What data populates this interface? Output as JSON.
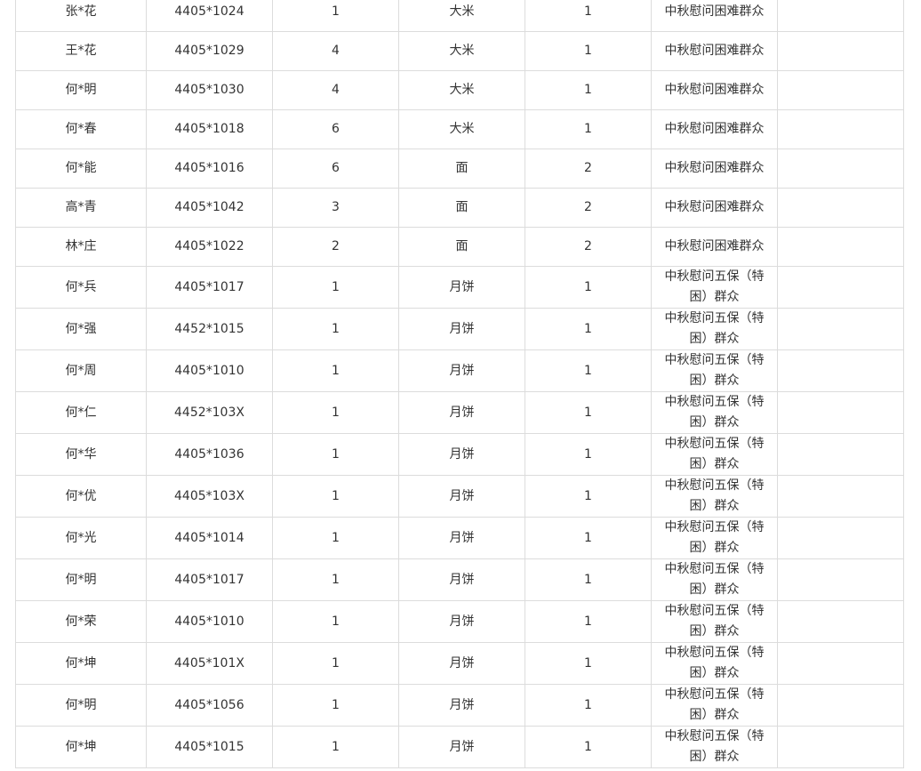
{
  "rows": [
    {
      "name": "张*花",
      "id": "4405*1024",
      "count": "1",
      "item": "大米",
      "qty": "1",
      "category": "中秋慰问困难群众",
      "note": ""
    },
    {
      "name": "王*花",
      "id": "4405*1029",
      "count": "4",
      "item": "大米",
      "qty": "1",
      "category": "中秋慰问困难群众",
      "note": ""
    },
    {
      "name": "何*明",
      "id": "4405*1030",
      "count": "4",
      "item": "大米",
      "qty": "1",
      "category": "中秋慰问困难群众",
      "note": ""
    },
    {
      "name": "何*春",
      "id": "4405*1018",
      "count": "6",
      "item": "大米",
      "qty": "1",
      "category": "中秋慰问困难群众",
      "note": ""
    },
    {
      "name": "何*能",
      "id": "4405*1016",
      "count": "6",
      "item": "面",
      "qty": "2",
      "category": "中秋慰问困难群众",
      "note": ""
    },
    {
      "name": "高*青",
      "id": "4405*1042",
      "count": "3",
      "item": "面",
      "qty": "2",
      "category": "中秋慰问困难群众",
      "note": ""
    },
    {
      "name": "林*庄",
      "id": "4405*1022",
      "count": "2",
      "item": "面",
      "qty": "2",
      "category": "中秋慰问困难群众",
      "note": ""
    },
    {
      "name": "何*兵",
      "id": "4405*1017",
      "count": "1",
      "item": "月饼",
      "qty": "1",
      "category": "中秋慰问五保（特困）群众",
      "note": ""
    },
    {
      "name": "何*强",
      "id": "4452*1015",
      "count": "1",
      "item": "月饼",
      "qty": "1",
      "category": "中秋慰问五保（特困）群众",
      "note": ""
    },
    {
      "name": "何*周",
      "id": "4405*1010",
      "count": "1",
      "item": "月饼",
      "qty": "1",
      "category": "中秋慰问五保（特困）群众",
      "note": ""
    },
    {
      "name": "何*仁",
      "id": "4452*103X",
      "count": "1",
      "item": "月饼",
      "qty": "1",
      "category": "中秋慰问五保（特困）群众",
      "note": ""
    },
    {
      "name": "何*华",
      "id": "4405*1036",
      "count": "1",
      "item": "月饼",
      "qty": "1",
      "category": "中秋慰问五保（特困）群众",
      "note": ""
    },
    {
      "name": "何*优",
      "id": "4405*103X",
      "count": "1",
      "item": "月饼",
      "qty": "1",
      "category": "中秋慰问五保（特困）群众",
      "note": ""
    },
    {
      "name": "何*光",
      "id": "4405*1014",
      "count": "1",
      "item": "月饼",
      "qty": "1",
      "category": "中秋慰问五保（特困）群众",
      "note": ""
    },
    {
      "name": "何*明",
      "id": "4405*1017",
      "count": "1",
      "item": "月饼",
      "qty": "1",
      "category": "中秋慰问五保（特困）群众",
      "note": ""
    },
    {
      "name": "何*荣",
      "id": "4405*1010",
      "count": "1",
      "item": "月饼",
      "qty": "1",
      "category": "中秋慰问五保（特困）群众",
      "note": ""
    },
    {
      "name": "何*坤",
      "id": "4405*101X",
      "count": "1",
      "item": "月饼",
      "qty": "1",
      "category": "中秋慰问五保（特困）群众",
      "note": ""
    },
    {
      "name": "何*明",
      "id": "4405*1056",
      "count": "1",
      "item": "月饼",
      "qty": "1",
      "category": "中秋慰问五保（特困）群众",
      "note": ""
    },
    {
      "name": "何*坤",
      "id": "4405*1015",
      "count": "1",
      "item": "月饼",
      "qty": "1",
      "category": "中秋慰问五保（特困）群众",
      "note": ""
    }
  ]
}
